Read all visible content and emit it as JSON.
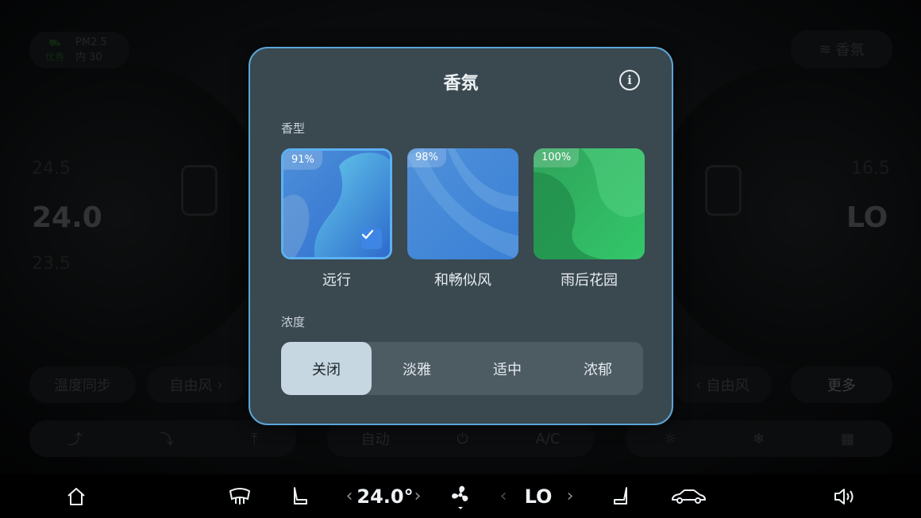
{
  "background": {
    "air_quality": {
      "label": "PM2.5",
      "status": "优秀",
      "inner": "内 30"
    },
    "fragrance_chip": "香氛",
    "left_temp": {
      "upper": "24.5",
      "current": "24.0",
      "lower": "23.5"
    },
    "right_temp": {
      "upper": "16.5",
      "current": "LO"
    },
    "left_row": {
      "sync": "温度同步",
      "free_air": "自由风"
    },
    "right_row": {
      "free_air": "自由风",
      "more": "更多"
    },
    "mid_row": {
      "auto": "自动",
      "ac": "A/C"
    }
  },
  "dialog": {
    "title": "香氛",
    "type_section": "香型",
    "scents": [
      {
        "name": "远行",
        "percent": "91%",
        "selected": true
      },
      {
        "name": "和畅似风",
        "percent": "98%",
        "selected": false
      },
      {
        "name": "雨后花园",
        "percent": "100%",
        "selected": false
      }
    ],
    "intensity_section": "浓度",
    "intensity": [
      {
        "label": "关闭",
        "active": true
      },
      {
        "label": "淡雅",
        "active": false
      },
      {
        "label": "适中",
        "active": false
      },
      {
        "label": "浓郁",
        "active": false
      }
    ]
  },
  "bottom_bar": {
    "driver_temp": "24.0°",
    "passenger_temp": "LO"
  },
  "colors": {
    "dialog_bg": "#3a4850",
    "dialog_border": "#5aa6d6",
    "selected_accent": "#3d86e6",
    "segment_active": "#c6d7e1"
  }
}
